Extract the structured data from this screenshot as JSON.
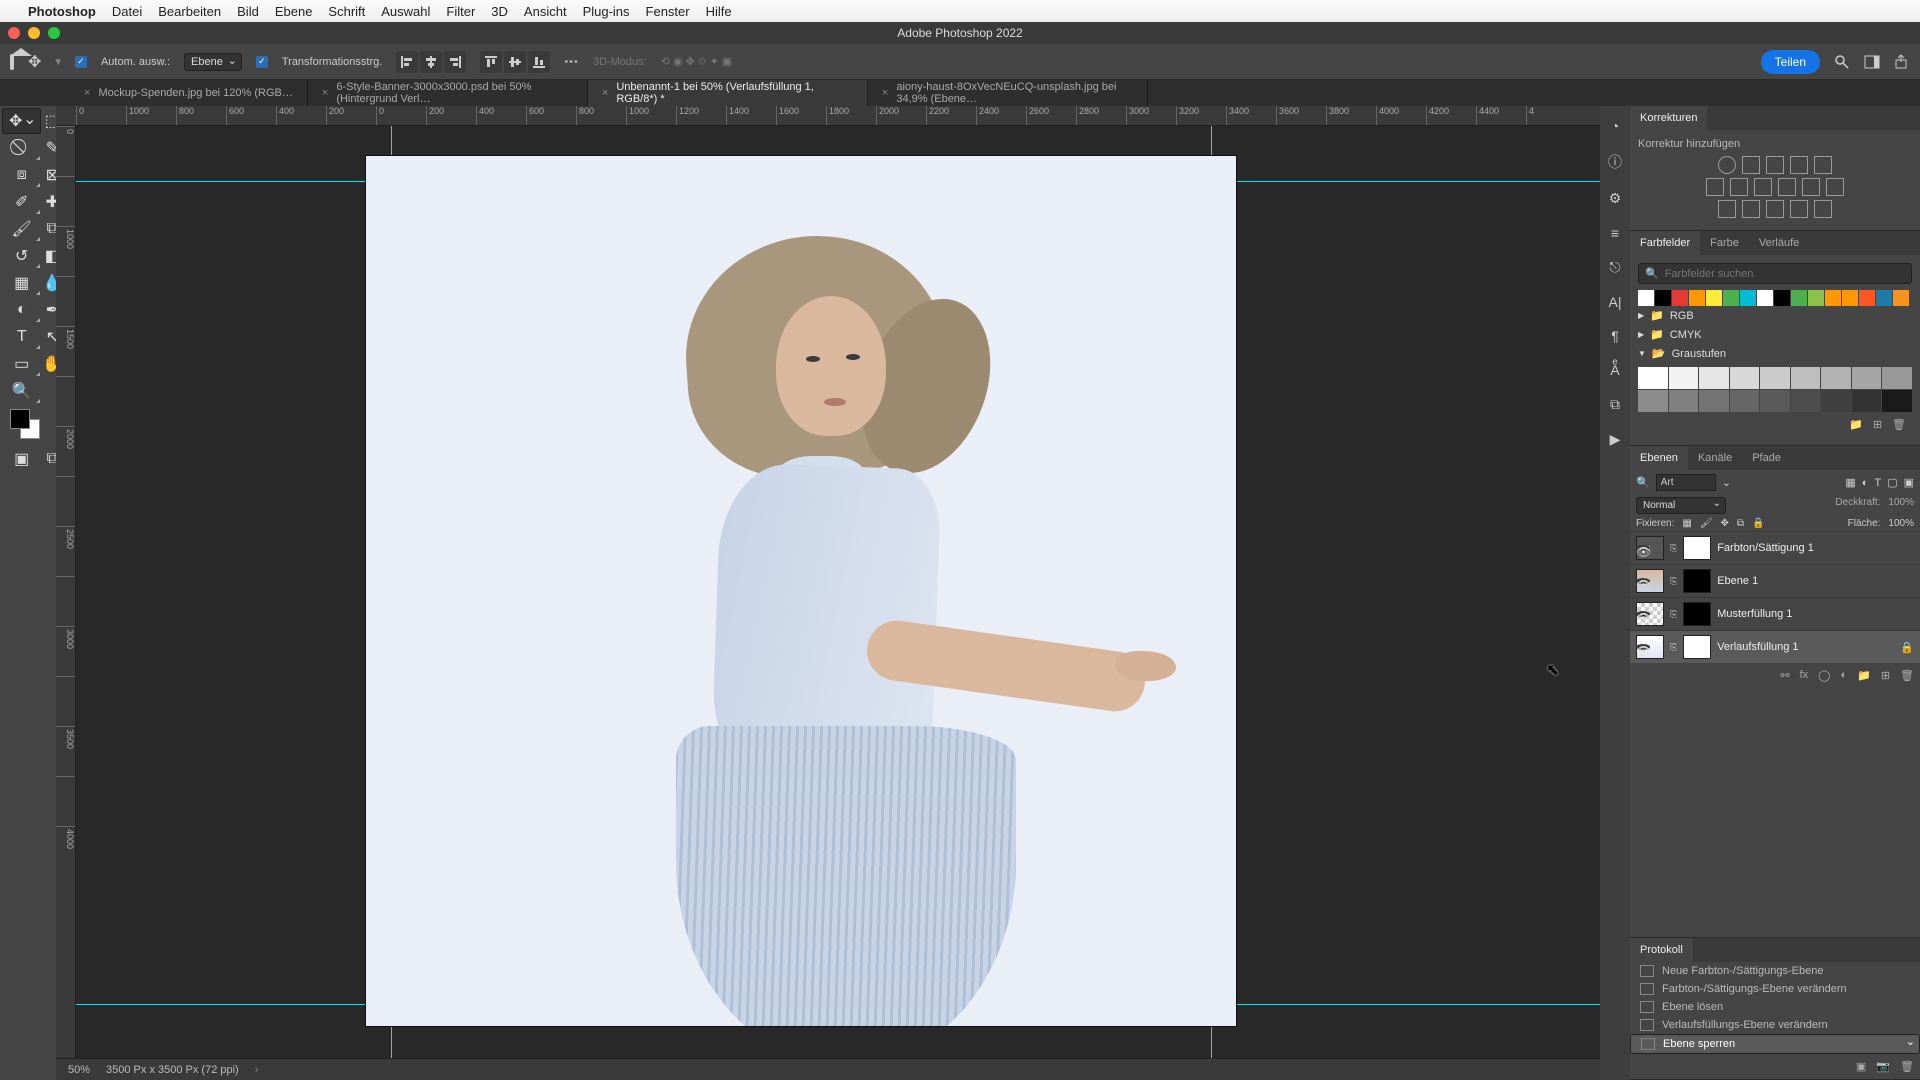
{
  "mac_menu": {
    "app": "Photoshop",
    "items": [
      "Datei",
      "Bearbeiten",
      "Bild",
      "Ebene",
      "Schrift",
      "Auswahl",
      "Filter",
      "3D",
      "Ansicht",
      "Plug-ins",
      "Fenster",
      "Hilfe"
    ]
  },
  "titlebar": "Adobe Photoshop 2022",
  "options": {
    "auto_select": "Autom. ausw.:",
    "auto_target": "Ebene",
    "transform": "Transformationsstrg.",
    "mode3d": "3D-Modus:",
    "share": "Teilen"
  },
  "doc_tabs": [
    {
      "label": "Mockup-Spenden.jpg bei 120% (RGB…",
      "active": false
    },
    {
      "label": "6-Style-Banner-3000x3000.psd bei 50% (Hintergrund Verl…",
      "active": false
    },
    {
      "label": "Unbenannt-1 bei 50% (Verlaufsfüllung 1, RGB/8*) *",
      "active": true
    },
    {
      "label": "aiony-haust-8OxVecNEuCQ-unsplash.jpg bei 34,9% (Ebene…",
      "active": false
    }
  ],
  "ruler_h": [
    "0",
    "1000",
    "800",
    "600",
    "400",
    "200",
    "0",
    "200",
    "400",
    "600",
    "800",
    "1000",
    "1200",
    "1400",
    "1600",
    "1800",
    "2000",
    "2200",
    "2400",
    "2600",
    "2800",
    "3000",
    "3200",
    "3400",
    "3600",
    "3800",
    "4000",
    "4200",
    "4400",
    "4"
  ],
  "ruler_v": [
    "0",
    "",
    "1000",
    "",
    "1500",
    "",
    "2000",
    "",
    "2500",
    "",
    "3000",
    "",
    "3500",
    "",
    "4000"
  ],
  "adjustments": {
    "title": "Korrekturen",
    "add": "Korrektur hinzufügen"
  },
  "swatches": {
    "tabs": [
      "Farbfelder",
      "Farbe",
      "Verläufe"
    ],
    "search_ph": "Farbfelder suchen",
    "row1": [
      "#ffffff",
      "#000000",
      "#e53935",
      "#ff9800",
      "#ffeb3b",
      "#4caf50",
      "#00bcd4",
      "#ffffff",
      "#000000",
      "#4caf50",
      "#8bc34a",
      "#ff9800",
      "#ff9800",
      "#ff5722",
      "#1f7aa8",
      "#f7931e"
    ],
    "folders": [
      {
        "name": "RGB",
        "open": false
      },
      {
        "name": "CMYK",
        "open": false
      },
      {
        "name": "Graustufen",
        "open": true
      }
    ],
    "grays": [
      "#ffffff",
      "#f2f2f2",
      "#e5e5e5",
      "#d8d8d8",
      "#cccccc",
      "#bfbfbf",
      "#b2b2b2",
      "#a5a5a5",
      "#999999",
      "#8c8c8c",
      "#808080",
      "#737373",
      "#666666",
      "#595959",
      "#4d4d4d",
      "#404040",
      "#333333",
      "#1a1a1a"
    ]
  },
  "layers": {
    "tabs": [
      "Ebenen",
      "Kanäle",
      "Pfade"
    ],
    "filter": "Art",
    "blend": "Normal",
    "opacity_lbl": "Deckkraft:",
    "opacity": "100%",
    "lock_lbl": "Fixieren:",
    "fill_lbl": "Fläche:",
    "fill": "100%",
    "items": [
      {
        "name": "Farbton/Sättigung 1",
        "type": "hs",
        "locked": false
      },
      {
        "name": "Ebene 1",
        "type": "img",
        "locked": false
      },
      {
        "name": "Musterfüllung 1",
        "type": "pat",
        "locked": false
      },
      {
        "name": "Verlaufsfüllung 1",
        "type": "grad",
        "locked": true
      }
    ]
  },
  "history": {
    "title": "Protokoll",
    "items": [
      "Neue Farbton-/Sättigungs-Ebene",
      "Farbton-/Sättigungs-Ebene verändern",
      "Ebene lösen",
      "Verlaufsfüllungs-Ebene verändern",
      "Ebene sperren"
    ],
    "selected": 4
  },
  "status": {
    "zoom": "50%",
    "dims": "3500 Px x 3500 Px (72 ppi)"
  }
}
